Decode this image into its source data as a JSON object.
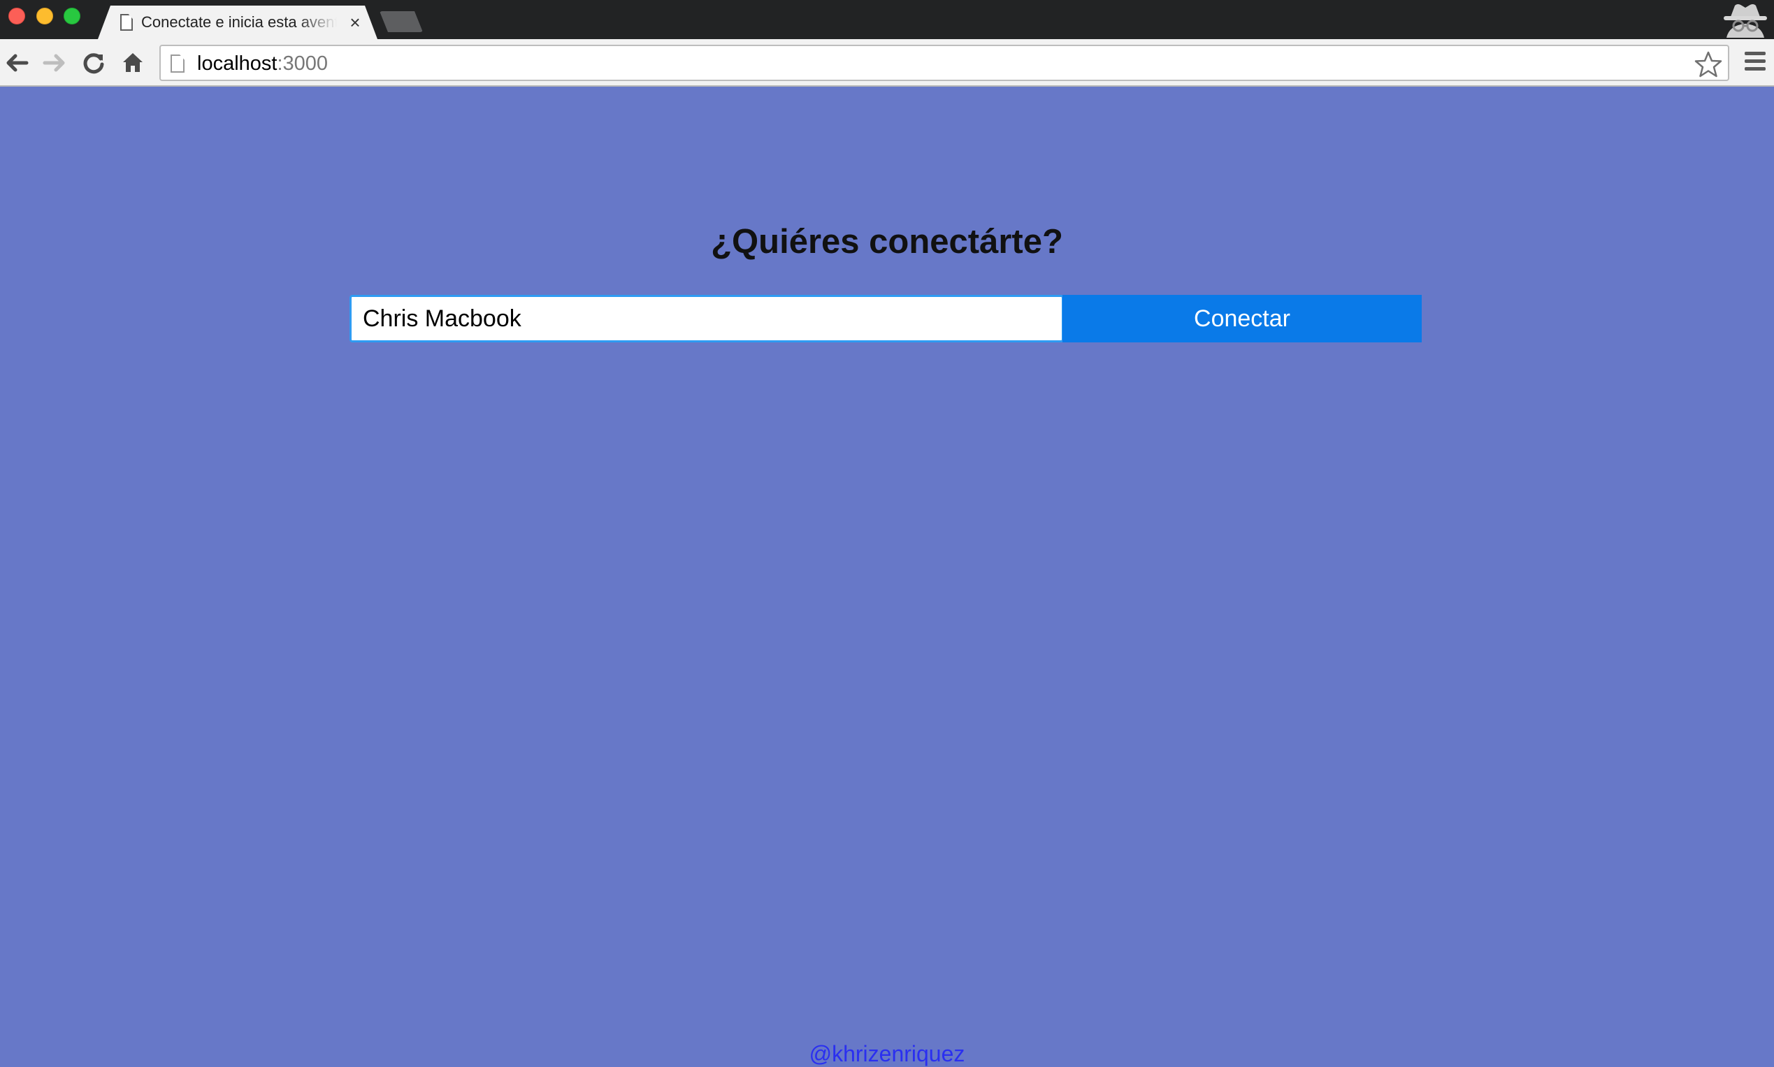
{
  "browser": {
    "tab_title": "Conectate e inicia esta aventura",
    "tab_close_symbol": "×",
    "address_host": "localhost",
    "address_port": ":3000",
    "icons": [
      "back-arrow-icon",
      "forward-arrow-icon",
      "reload-icon",
      "home-icon",
      "page-icon",
      "star-icon",
      "menu-icon",
      "incognito-icon"
    ]
  },
  "page": {
    "background_color": "#6778c8",
    "heading": "¿Quiéres conectárte?",
    "name_input_value": "Chris Macbook",
    "connect_button_label": "Conectar",
    "connect_button_color": "#0a7ae8",
    "footer_link": "@khrizenriquez"
  }
}
